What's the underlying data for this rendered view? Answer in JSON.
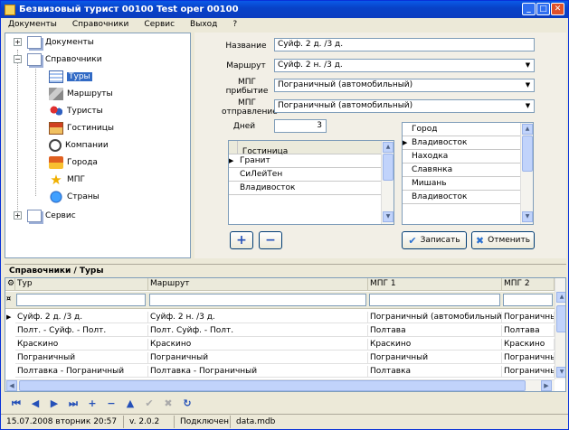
{
  "window": {
    "title": "Безвизовый турист  00100  Test oper 00100"
  },
  "menu": [
    "Документы",
    "Справочники",
    "Сервис",
    "Выход",
    "?"
  ],
  "tree": {
    "items": [
      {
        "label": "Документы",
        "icon": "document-icon"
      },
      {
        "label": "Справочники",
        "icon": "document-icon"
      },
      {
        "label": "Туры",
        "icon": "table-icon"
      },
      {
        "label": "Маршруты",
        "icon": "route-icon"
      },
      {
        "label": "Туристы",
        "icon": "people-icon"
      },
      {
        "label": "Гостиницы",
        "icon": "hotel-icon"
      },
      {
        "label": "Компании",
        "icon": "company-icon"
      },
      {
        "label": "Города",
        "icon": "city-icon"
      },
      {
        "label": "МПГ",
        "icon": "star-icon"
      },
      {
        "label": "Страны",
        "icon": "globe-icon"
      },
      {
        "label": "Сервис",
        "icon": "document-icon"
      }
    ]
  },
  "form": {
    "name_label": "Название",
    "name_value": "Суйф. 2 д. /3 д.",
    "route_label": "Маршрут",
    "route_value": "Суйф. 2 н. /3 д.",
    "mpg_arrival_label": "МПГ прибытие",
    "mpg_arrival_value": "Пограничный (автомобильный)",
    "mpg_departure_label": "МПГ отправление",
    "mpg_departure_value": "Пограничный (автомобильный)",
    "days_label": "Дней",
    "days_value": "3",
    "hotel_header": "Гостиница",
    "hotels": [
      "Гранит",
      "СиЛейТен",
      "Владивосток"
    ],
    "city_header": "Город",
    "cities": [
      "Владивосток",
      "Находка",
      "Славянка",
      "Мишань",
      "Владивосток"
    ],
    "save_label": "Записать",
    "cancel_label": "Отменить"
  },
  "bottom": {
    "title": "Справочники / Туры",
    "columns": [
      "Тур",
      "Маршрут",
      "МПГ 1",
      "МПГ 2"
    ],
    "rows": [
      [
        "Суйф. 2 д. /3 д.",
        "Суйф. 2 н. /3 д.",
        "Пограничный (автомобильный)",
        "Пограничный"
      ],
      [
        "Полт. - Суйф. - Полт.",
        "Полт. Суйф. - Полт.",
        "Полтава",
        "Полтава"
      ],
      [
        "Краскино",
        "Краскино",
        "Краскино",
        "Краскино"
      ],
      [
        "Пограничный",
        "Пограничный",
        "Пограничный",
        "Пограничный"
      ],
      [
        "Полтавка - Пограничный",
        "Полтавка - Пограничный",
        "Полтавка",
        "Пограничный"
      ]
    ]
  },
  "status": {
    "date": "15.07.2008  вторник  20:57",
    "version": "v. 2.0.2",
    "connection": "Подключен",
    "db": "data.mdb"
  }
}
